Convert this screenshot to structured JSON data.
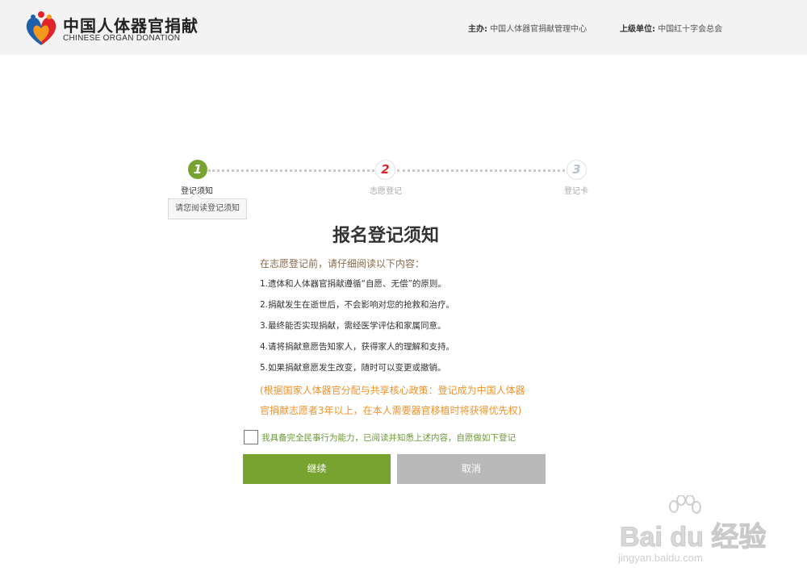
{
  "header": {
    "logo_cn": "中国人体器官捐献",
    "logo_en": "CHINESE ORGAN DONATION",
    "host_label": "主办:",
    "host_value": "中国人体器官捐献管理中心",
    "superior_label": "上级单位:",
    "superior_value": "中国红十字会总会"
  },
  "steps": {
    "items": [
      {
        "number": "1",
        "label": "登记须知",
        "state": "active"
      },
      {
        "number": "2",
        "label": "志愿登记",
        "state": "pending"
      },
      {
        "number": "3",
        "label": "登记卡",
        "state": "pending"
      }
    ],
    "tip": "请您阅读登记须知"
  },
  "notice": {
    "title": "报名登记须知",
    "intro": "在志愿登记前，请仔细阅读以下内容：",
    "rules": [
      "1.遗体和人体器官捐献遵循“自愿、无偿”的原则。",
      "2.捐献发生在逝世后，不会影响对您的抢救和治疗。",
      "3.最终能否实现捐献，需经医学评估和家属同意。",
      "4.请将捐献意愿告知家人，获得家人的理解和支持。",
      "5.如果捐献意愿发生改变，随时可以变更或撤销。"
    ],
    "policy_line1": "(根据国家人体器官分配与共享核心政策：登记成为中国人体器",
    "policy_line2": "官捐献志愿者3年以上，在本人需要器官移植时将获得优先权)"
  },
  "agreement": {
    "checked": false,
    "text": "我具备完全民事行为能力，已阅读并知悉上述内容，自愿做如下登记"
  },
  "buttons": {
    "continue_label": "继续",
    "cancel_label": "取消"
  },
  "watermark": {
    "brand": "Bai du 经验",
    "url": "jingyan.baidu.com"
  },
  "colors": {
    "accent_green": "#78a330",
    "step2_red": "#e0242a",
    "inactive_grey": "#b9b9b9",
    "policy_orange": "#f0932b"
  }
}
